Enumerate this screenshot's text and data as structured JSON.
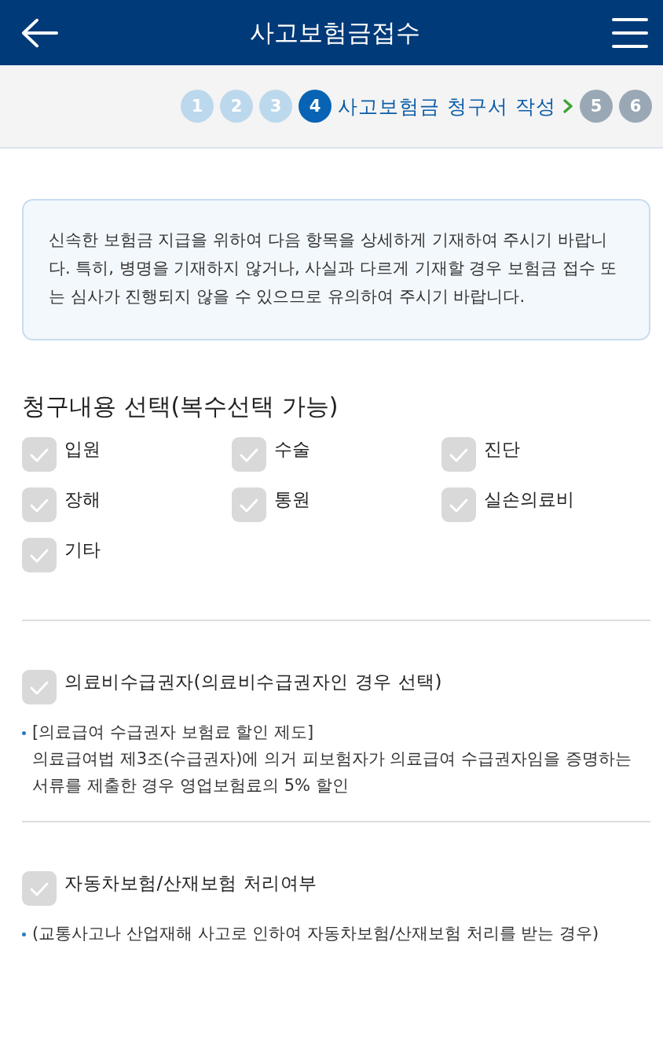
{
  "header": {
    "title": "사고보험금접수"
  },
  "steps": [
    {
      "label": "1",
      "completed": true,
      "selected": false
    },
    {
      "label": "2",
      "completed": true,
      "selected": false
    },
    {
      "label": "3",
      "completed": true,
      "selected": false
    },
    {
      "label": "4",
      "completed": false,
      "selected": true,
      "caption": "사고보험금 청구서 작성"
    },
    {
      "label": "5",
      "completed": false,
      "selected": false
    },
    {
      "label": "6",
      "completed": false,
      "selected": false
    }
  ],
  "notice": "신속한 보험금 지급을 위하여 다음 항목을 상세하게 기재하여 주시기 바랍니다. 특히, 병명을 기재하지 않거나, 사실과 다르게 기재할 경우 보험금 접수 또는 심사가 진행되지 않을 수 있으므로 유의하여 주시기 바랍니다.",
  "claim_section": {
    "title": "청구내용 선택(복수선택 가능)",
    "options": [
      {
        "label": "입원",
        "checked": false
      },
      {
        "label": "수술",
        "checked": false
      },
      {
        "label": "진단",
        "checked": false
      },
      {
        "label": "장해",
        "checked": false
      },
      {
        "label": "통원",
        "checked": false
      },
      {
        "label": "실손의료비",
        "checked": false
      },
      {
        "label": "기타",
        "checked": false
      }
    ]
  },
  "extra_sections": [
    {
      "label": "의료비수급권자(의료비수급권자인 경우 선택)",
      "checked": false,
      "note": [
        "[의료급여 수급권자 보험료 할인 제도]",
        "의료급여법 제3조(수급권자)에 의거 피보험자가 의료급여 수급권자임을 증명하는 서류를 제출한 경우 영업보험료의 5% 할인"
      ]
    },
    {
      "label": "자동차보험/산재보험 처리여부",
      "checked": false,
      "note": [
        "(교통사고나 산업재해 사고로 인하여 자동차보험/산재보험 처리를 받는 경우)"
      ]
    }
  ]
}
